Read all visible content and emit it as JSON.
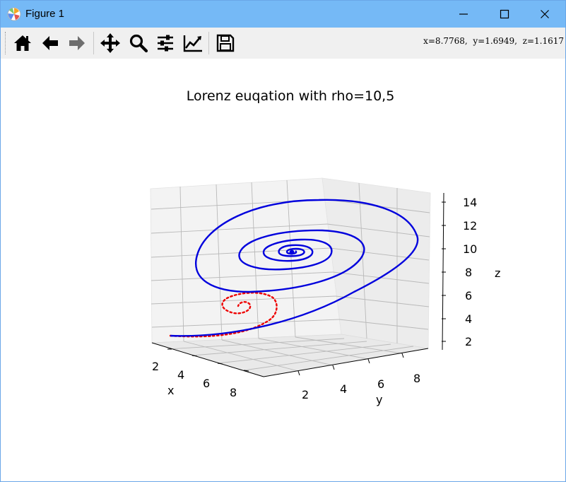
{
  "window": {
    "title": "Figure 1"
  },
  "status": {
    "coordinates": "x=8.7768,  y=1.6949,  z=1.1617"
  },
  "toolbar": {
    "buttons": [
      {
        "icon": "home-icon"
      },
      {
        "icon": "back-arrow-icon"
      },
      {
        "icon": "forward-arrow-icon"
      },
      {
        "icon": "pan-icon"
      },
      {
        "icon": "zoom-icon"
      },
      {
        "icon": "configure-subplots-icon"
      },
      {
        "icon": "edit-axis-icon"
      },
      {
        "icon": "save-icon"
      }
    ]
  },
  "plot": {
    "title": "Lorenz euqation with rho=10,5",
    "x_axis": {
      "label": "x",
      "ticks": [
        "2",
        "4",
        "6",
        "8"
      ]
    },
    "y_axis": {
      "label": "y",
      "ticks": [
        "2",
        "4",
        "6",
        "8"
      ]
    },
    "z_axis": {
      "label": "z",
      "ticks": [
        "2",
        "4",
        "6",
        "8",
        "10",
        "12",
        "14"
      ]
    },
    "colors": {
      "solid_series": "#0000dd",
      "dotted_series": "#ee0000"
    }
  },
  "chart_data": {
    "type": "line",
    "title": "Lorenz euqation with rho=10,5",
    "xlabel": "x",
    "ylabel": "y",
    "zlabel": "z",
    "series": [
      {
        "style": "solid",
        "color": "#0000dd",
        "approx_start": [
          2.0,
          1.5,
          2.0
        ],
        "approx_end": [
          9.0,
          9.0,
          9.5
        ]
      },
      {
        "style": "dotted",
        "color": "#ee0000",
        "approx_start": [
          2.0,
          1.5,
          2.0
        ],
        "approx_end": [
          3.5,
          3.5,
          3.5
        ]
      }
    ],
    "xlim": [
      1,
      9
    ],
    "ylim": [
      1,
      9
    ],
    "zlim": [
      1,
      15
    ]
  }
}
